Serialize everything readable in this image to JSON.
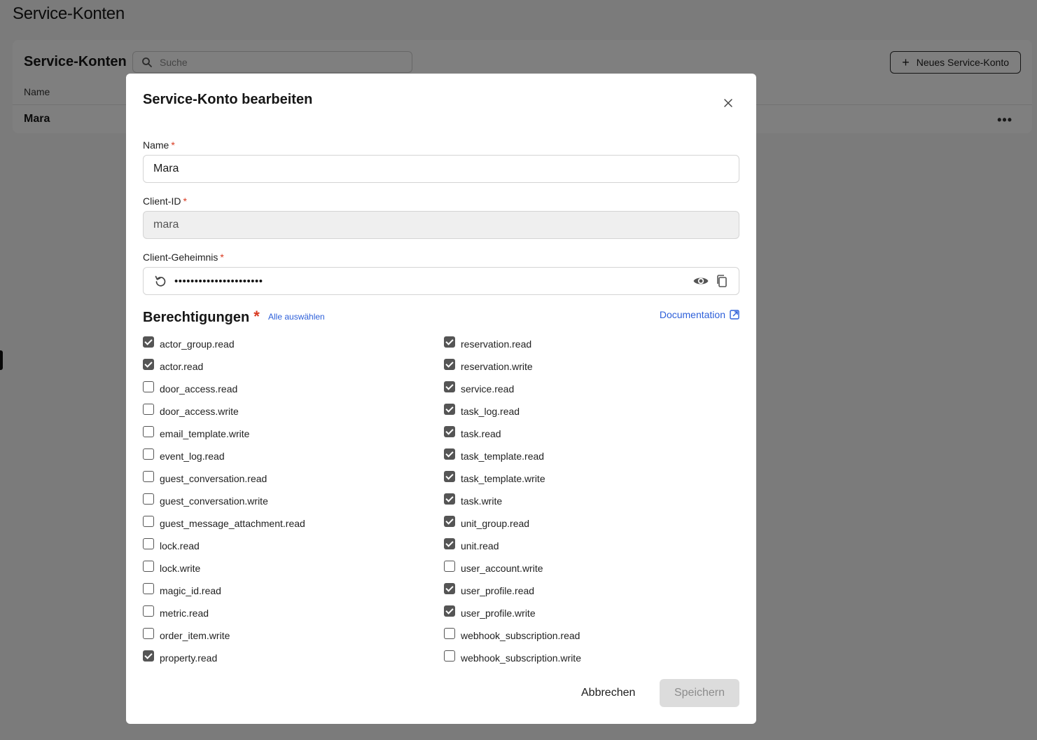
{
  "page": {
    "title": "Service-Konten",
    "card_title": "Service-Konten",
    "search_placeholder": "Suche",
    "new_button": "Neues Service-Konto",
    "column_name": "Name",
    "rows": [
      {
        "name": "Mara"
      }
    ]
  },
  "modal": {
    "title": "Service-Konto bearbeiten",
    "name_label": "Name",
    "name_value": "Mara",
    "client_id_label": "Client-ID",
    "client_id_value": "mara",
    "secret_label": "Client-Geheimnis",
    "secret_value": "••••••••••••••••••••••",
    "required_mark": "*",
    "permissions_title": "Berechtigungen",
    "select_all": "Alle auswählen",
    "documentation": "Documentation",
    "cancel": "Abbrechen",
    "save": "Speichern",
    "permissions_left": [
      {
        "label": "actor_group.read",
        "checked": true
      },
      {
        "label": "actor.read",
        "checked": true
      },
      {
        "label": "door_access.read",
        "checked": false
      },
      {
        "label": "door_access.write",
        "checked": false
      },
      {
        "label": "email_template.write",
        "checked": false
      },
      {
        "label": "event_log.read",
        "checked": false
      },
      {
        "label": "guest_conversation.read",
        "checked": false
      },
      {
        "label": "guest_conversation.write",
        "checked": false
      },
      {
        "label": "guest_message_attachment.read",
        "checked": false
      },
      {
        "label": "lock.read",
        "checked": false
      },
      {
        "label": "lock.write",
        "checked": false
      },
      {
        "label": "magic_id.read",
        "checked": false
      },
      {
        "label": "metric.read",
        "checked": false
      },
      {
        "label": "order_item.write",
        "checked": false
      },
      {
        "label": "property.read",
        "checked": true
      }
    ],
    "permissions_right": [
      {
        "label": "reservation.read",
        "checked": true
      },
      {
        "label": "reservation.write",
        "checked": true
      },
      {
        "label": "service.read",
        "checked": true
      },
      {
        "label": "task_log.read",
        "checked": true
      },
      {
        "label": "task.read",
        "checked": true
      },
      {
        "label": "task_template.read",
        "checked": true
      },
      {
        "label": "task_template.write",
        "checked": true
      },
      {
        "label": "task.write",
        "checked": true
      },
      {
        "label": "unit_group.read",
        "checked": true
      },
      {
        "label": "unit.read",
        "checked": true
      },
      {
        "label": "user_account.write",
        "checked": false
      },
      {
        "label": "user_profile.read",
        "checked": true
      },
      {
        "label": "user_profile.write",
        "checked": true
      },
      {
        "label": "webhook_subscription.read",
        "checked": false
      },
      {
        "label": "webhook_subscription.write",
        "checked": false
      }
    ]
  },
  "colors": {
    "accent_link": "#2d5fd9",
    "required": "#d93a20",
    "checkbox_checked": "#555555",
    "overlay": "rgba(0,0,0,0.5)"
  }
}
